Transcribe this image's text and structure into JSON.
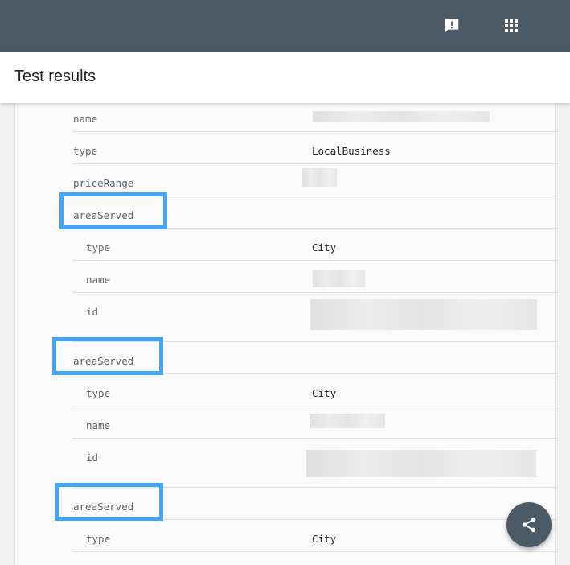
{
  "header": {
    "feedback_icon": "feedback-icon",
    "apps_icon": "apps-grid-icon"
  },
  "title": "Test results",
  "rows": [
    {
      "key": "name",
      "value": ""
    },
    {
      "key": "type",
      "value": "LocalBusiness"
    },
    {
      "key": "priceRange",
      "value": ""
    },
    {
      "key": "areaServed",
      "value": ""
    },
    {
      "key": "type",
      "value": "City"
    },
    {
      "key": "name",
      "value": ""
    },
    {
      "key": "id",
      "value": ""
    },
    {
      "key": "areaServed",
      "value": ""
    },
    {
      "key": "type",
      "value": "City"
    },
    {
      "key": "name",
      "value": ""
    },
    {
      "key": "id",
      "value": ""
    },
    {
      "key": "areaServed",
      "value": ""
    },
    {
      "key": "type",
      "value": "City"
    }
  ],
  "colors": {
    "header_bg": "#4b5a65",
    "highlight": "#42a5f5"
  },
  "share_icon": "share-icon"
}
